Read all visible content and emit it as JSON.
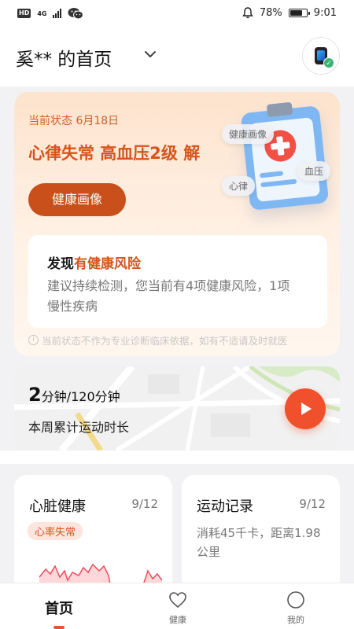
{
  "status_bar": {
    "network": "4G",
    "battery_percent": "78%",
    "battery_level": 0.78,
    "time": "9:01"
  },
  "header": {
    "title": "奚** 的首页"
  },
  "status_card": {
    "date_line": "当前状态 6月18日",
    "conditions": "心律失常 高血压2级 解",
    "portrait_button": "健康画像",
    "tags": {
      "portrait": "健康画像",
      "blood_pressure": "血压",
      "heart_rhythm": "心律"
    },
    "risk": {
      "title_prefix": "发现",
      "title_accent": "有健康风险",
      "description": "建议持续检测，您当前有4项健康风险，1项慢性疾病"
    },
    "disclaimer": "当前状态不作为专业诊断临床依据，如有不适请及时就医"
  },
  "exercise": {
    "minutes_done": "2",
    "minutes_goal": "分钟/120分钟",
    "label": "本周累计运动时长"
  },
  "heart_card": {
    "title": "心脏健康",
    "date": "9/12",
    "chip": "心率失常"
  },
  "sport_card": {
    "title": "运动记录",
    "date": "9/12",
    "description": "消耗45千卡，距离1.98公里"
  },
  "bottom_nav": {
    "home": "首页",
    "health": "健康",
    "mine": "我的"
  },
  "colors": {
    "accent": "#d6541c",
    "play": "#f1502c",
    "button": "#c9501a"
  }
}
